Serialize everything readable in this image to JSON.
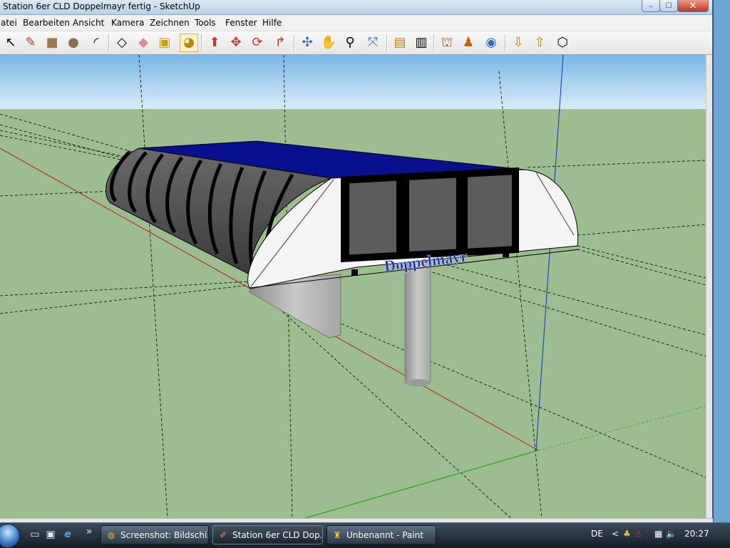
{
  "window": {
    "title": "Station 6er CLD Doppelmayr fertig - SketchUp",
    "controls": {
      "minimize": "–",
      "maximize": "☐",
      "close": "✕"
    }
  },
  "menu": [
    "atei",
    "Bearbeiten",
    "Ansicht",
    "Kamera",
    "Zeichnen",
    "Tools",
    "Fenster",
    "Hilfe"
  ],
  "toolbar": {
    "tools": [
      {
        "name": "select-icon",
        "glyph": "↖"
      },
      {
        "name": "pencil-icon",
        "glyph": "✎",
        "color": "#c0392b"
      },
      {
        "name": "rectangle-icon",
        "glyph": "■",
        "color": "#9a7b4f"
      },
      {
        "name": "circle-icon",
        "glyph": "●",
        "color": "#8b6e4e"
      },
      {
        "name": "arc-icon",
        "glyph": "◜"
      },
      {
        "name": "make-component-icon",
        "glyph": "◇"
      },
      {
        "name": "eraser-icon",
        "glyph": "◆",
        "color": "#e08aa0"
      },
      {
        "name": "tape-measure-icon",
        "glyph": "▣",
        "color": "#c8a020"
      },
      {
        "name": "paint-bucket-icon",
        "glyph": "◕",
        "color": "#b8860b",
        "active": true
      },
      {
        "name": "push-pull-icon",
        "glyph": "⬆",
        "color": "#c0392b"
      },
      {
        "name": "move-icon",
        "glyph": "✥",
        "color": "#c0392b"
      },
      {
        "name": "rotate-icon",
        "glyph": "⟳",
        "color": "#c0392b"
      },
      {
        "name": "follow-me-icon",
        "glyph": "↱",
        "color": "#c0392b"
      },
      {
        "name": "orbit-icon",
        "glyph": "✣",
        "color": "#2f6fb6"
      },
      {
        "name": "pan-icon",
        "glyph": "✋"
      },
      {
        "name": "zoom-icon",
        "glyph": "⚲"
      },
      {
        "name": "zoom-extents-icon",
        "glyph": "⤧",
        "color": "#2f6fb6"
      },
      {
        "name": "previous-view-icon",
        "glyph": "▤",
        "color": "#b8860b"
      },
      {
        "name": "next-view-icon",
        "glyph": "▥"
      },
      {
        "name": "position-camera-icon",
        "glyph": "⛫",
        "color": "#8b5a2b"
      },
      {
        "name": "walk-icon",
        "glyph": "♟",
        "color": "#c06000"
      },
      {
        "name": "look-around-icon",
        "glyph": "◉",
        "color": "#2f6fb6"
      },
      {
        "name": "get-models-icon",
        "glyph": "⇩",
        "color": "#b8860b"
      },
      {
        "name": "share-model-icon",
        "glyph": "⇧",
        "color": "#b8860b"
      },
      {
        "name": "share-component-icon",
        "glyph": "⬡"
      }
    ]
  },
  "scene": {
    "logo_text": "Doppelmayr",
    "colors": {
      "sky_top": "#7ab6e6",
      "sky_bottom": "#d9ecf8",
      "ground": "#9bbd8f",
      "roof": "#08108f",
      "logo": "#1a2fb0"
    }
  },
  "taskbar": {
    "tasks": [
      {
        "name": "task-chrome",
        "icon": "chrome-icon",
        "glyph": "◍",
        "label": "Screenshot: Bildschi...",
        "active": false
      },
      {
        "name": "task-sketchup",
        "icon": "sketchup-icon",
        "glyph": "✐",
        "label": "Station 6er CLD Dop...",
        "active": true
      },
      {
        "name": "task-paint",
        "icon": "paint-icon",
        "glyph": "♜",
        "label": "Unbenannt - Paint",
        "active": false
      }
    ],
    "overflow": "»",
    "tray": {
      "language": "DE",
      "chevron": "<",
      "time": "20:27"
    }
  }
}
